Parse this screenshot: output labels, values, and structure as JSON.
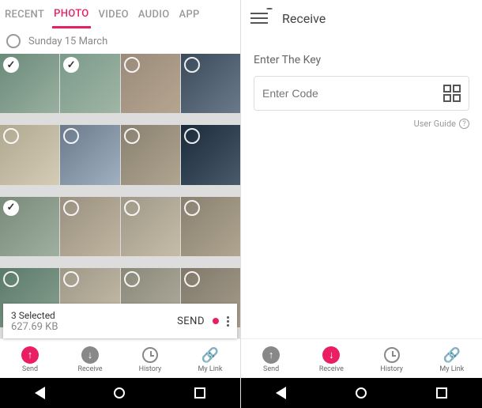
{
  "left": {
    "tabs": [
      "RECENT",
      "PHOTO",
      "VIDEO",
      "AUDIO",
      "APP"
    ],
    "date_header": "Sunday 15 March",
    "photos": [
      {
        "selected": true
      },
      {
        "selected": true
      },
      {
        "selected": false
      },
      {
        "selected": false
      },
      {
        "selected": false
      },
      {
        "selected": false
      },
      {
        "selected": false
      },
      {
        "selected": false
      },
      {
        "selected": true
      },
      {
        "selected": false
      },
      {
        "selected": false
      },
      {
        "selected": false
      },
      {
        "selected": false
      },
      {
        "selected": false
      },
      {
        "selected": false
      },
      {
        "selected": false
      }
    ],
    "info": {
      "count_text": "3 Selected",
      "size_text": "627.69 KB",
      "send_label": "SEND"
    }
  },
  "right": {
    "title": "Receive",
    "key_label": "Enter The Key",
    "code_placeholder": "Enter Code",
    "guide_label": "User Guide"
  },
  "nav": {
    "send": "Send",
    "receive": "Receive",
    "history": "History",
    "mylink": "My Link"
  },
  "colors": {
    "accent": "#e91e63"
  }
}
